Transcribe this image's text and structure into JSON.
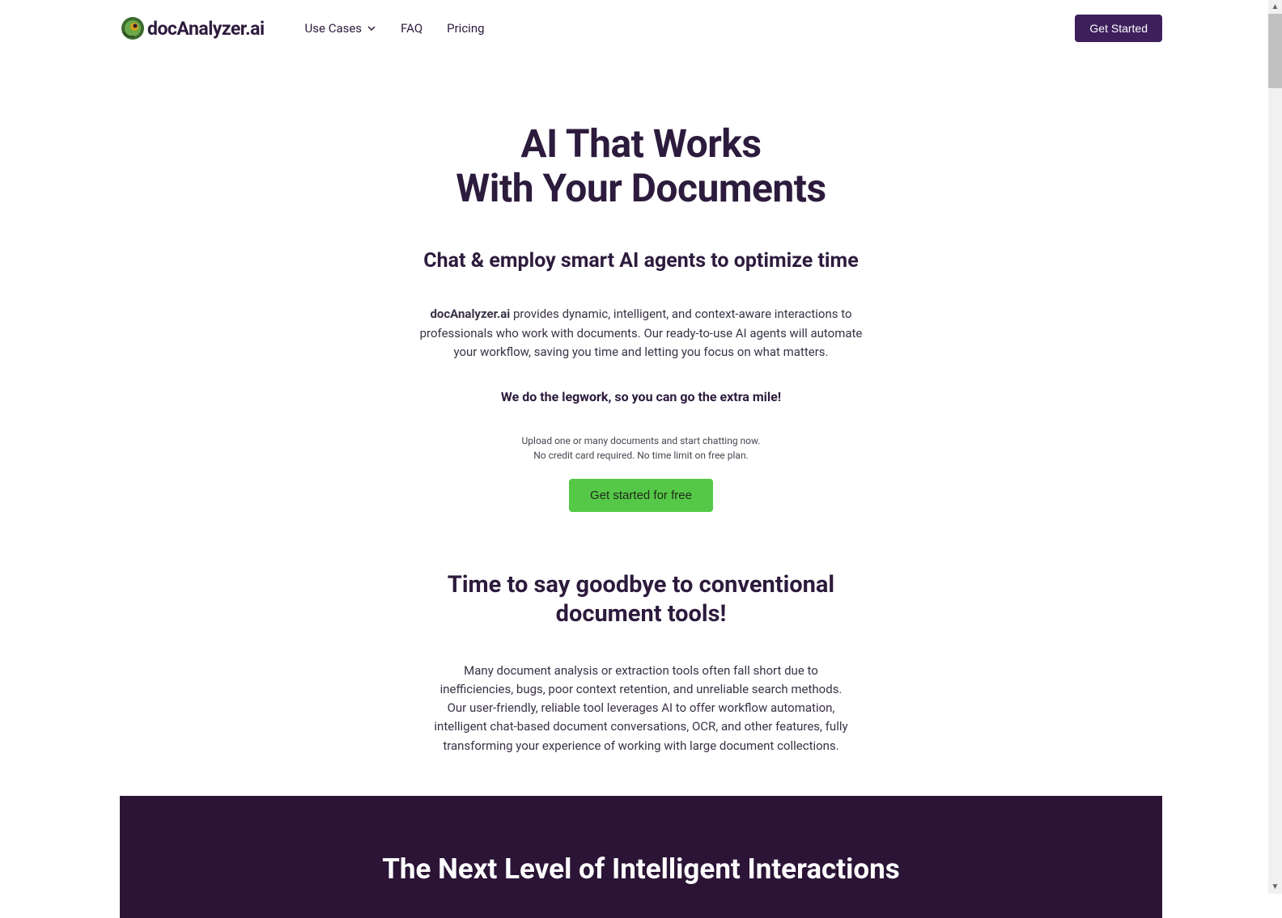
{
  "header": {
    "logo_text": "docAnalyzer.ai",
    "nav": {
      "use_cases": "Use Cases",
      "faq": "FAQ",
      "pricing": "Pricing"
    },
    "cta": "Get Started"
  },
  "hero": {
    "title_line1": "AI That Works",
    "title_line2": "With Your Documents",
    "subtitle": "Chat & employ smart AI agents to optimize time",
    "desc_brand": "docAnalyzer.ai",
    "desc_rest": " provides dynamic, intelligent, and context-aware interactions to professionals who work with documents. Our ready-to-use AI agents will automate your workflow, saving you time and letting you focus on what matters.",
    "tagline": "We do the legwork, so you can go the extra mile!",
    "fineprint_line1": "Upload one or many documents and start chatting now.",
    "fineprint_line2": "No credit card required. No time limit on free plan.",
    "cta": "Get started for free"
  },
  "section2": {
    "title": "Time to say goodbye to conventional document tools!",
    "desc": "Many document analysis or extraction tools often fall short due to inefficiencies, bugs, poor context retention, and unreliable search methods. Our user-friendly, reliable tool leverages AI to offer workflow automation, intelligent chat-based document conversations, OCR, and other features, fully transforming your experience of working with large document collections."
  },
  "dark_section": {
    "title": "The Next Level of Intelligent Interactions"
  }
}
